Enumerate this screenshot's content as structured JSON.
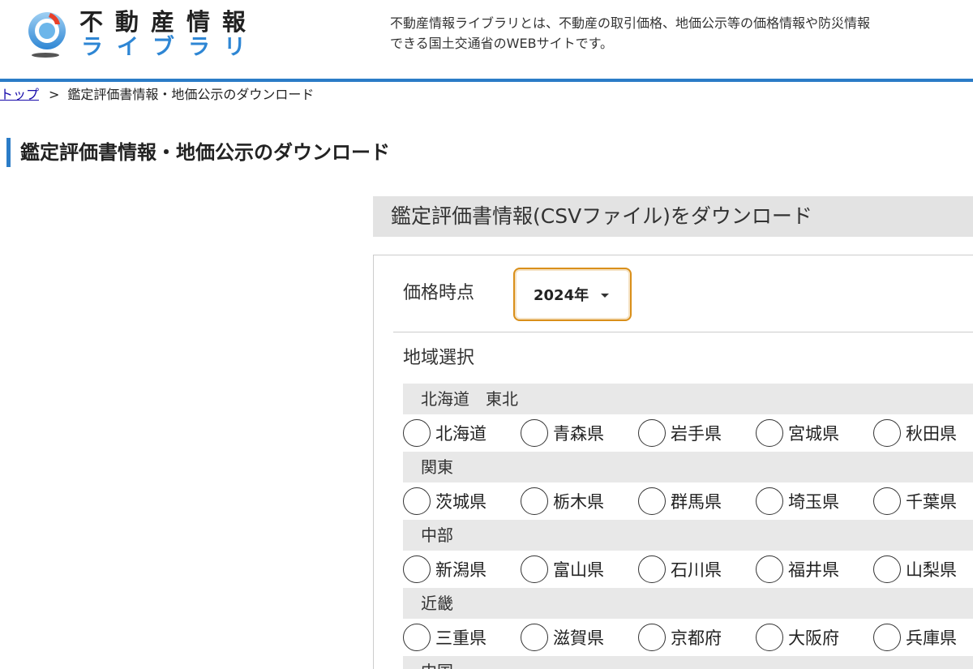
{
  "header": {
    "logo_line1": "不動産情報",
    "logo_line2": "ライブラリ",
    "description_line1": "不動産情報ライブラリとは、不動産の取引価格、地価公示等の価格情報や防災情報",
    "description_line2": "できる国土交通省のWEBサイトです。",
    "accent_color": "#2b7cc7"
  },
  "breadcrumb": {
    "home_link": "トップ",
    "separator": ">",
    "current": "鑑定評価書情報・地価公示のダウンロード"
  },
  "page_title": "鑑定評価書情報・地価公示のダウンロード",
  "section": {
    "title": "鑑定評価書情報(CSVファイル)をダウンロード",
    "price_label": "価格時点",
    "price_select_value": "2024年",
    "region_label": "地域選択",
    "groups": [
      {
        "name": "北海道　東北",
        "prefectures": [
          "北海道",
          "青森県",
          "岩手県",
          "宮城県",
          "秋田県"
        ]
      },
      {
        "name": "関東",
        "prefectures": [
          "茨城県",
          "栃木県",
          "群馬県",
          "埼玉県",
          "千葉県"
        ]
      },
      {
        "name": "中部",
        "prefectures": [
          "新潟県",
          "富山県",
          "石川県",
          "福井県",
          "山梨県"
        ]
      },
      {
        "name": "近畿",
        "prefectures": [
          "三重県",
          "滋賀県",
          "京都府",
          "大阪府",
          "兵庫県"
        ]
      },
      {
        "name": "中国",
        "prefectures": []
      }
    ]
  }
}
